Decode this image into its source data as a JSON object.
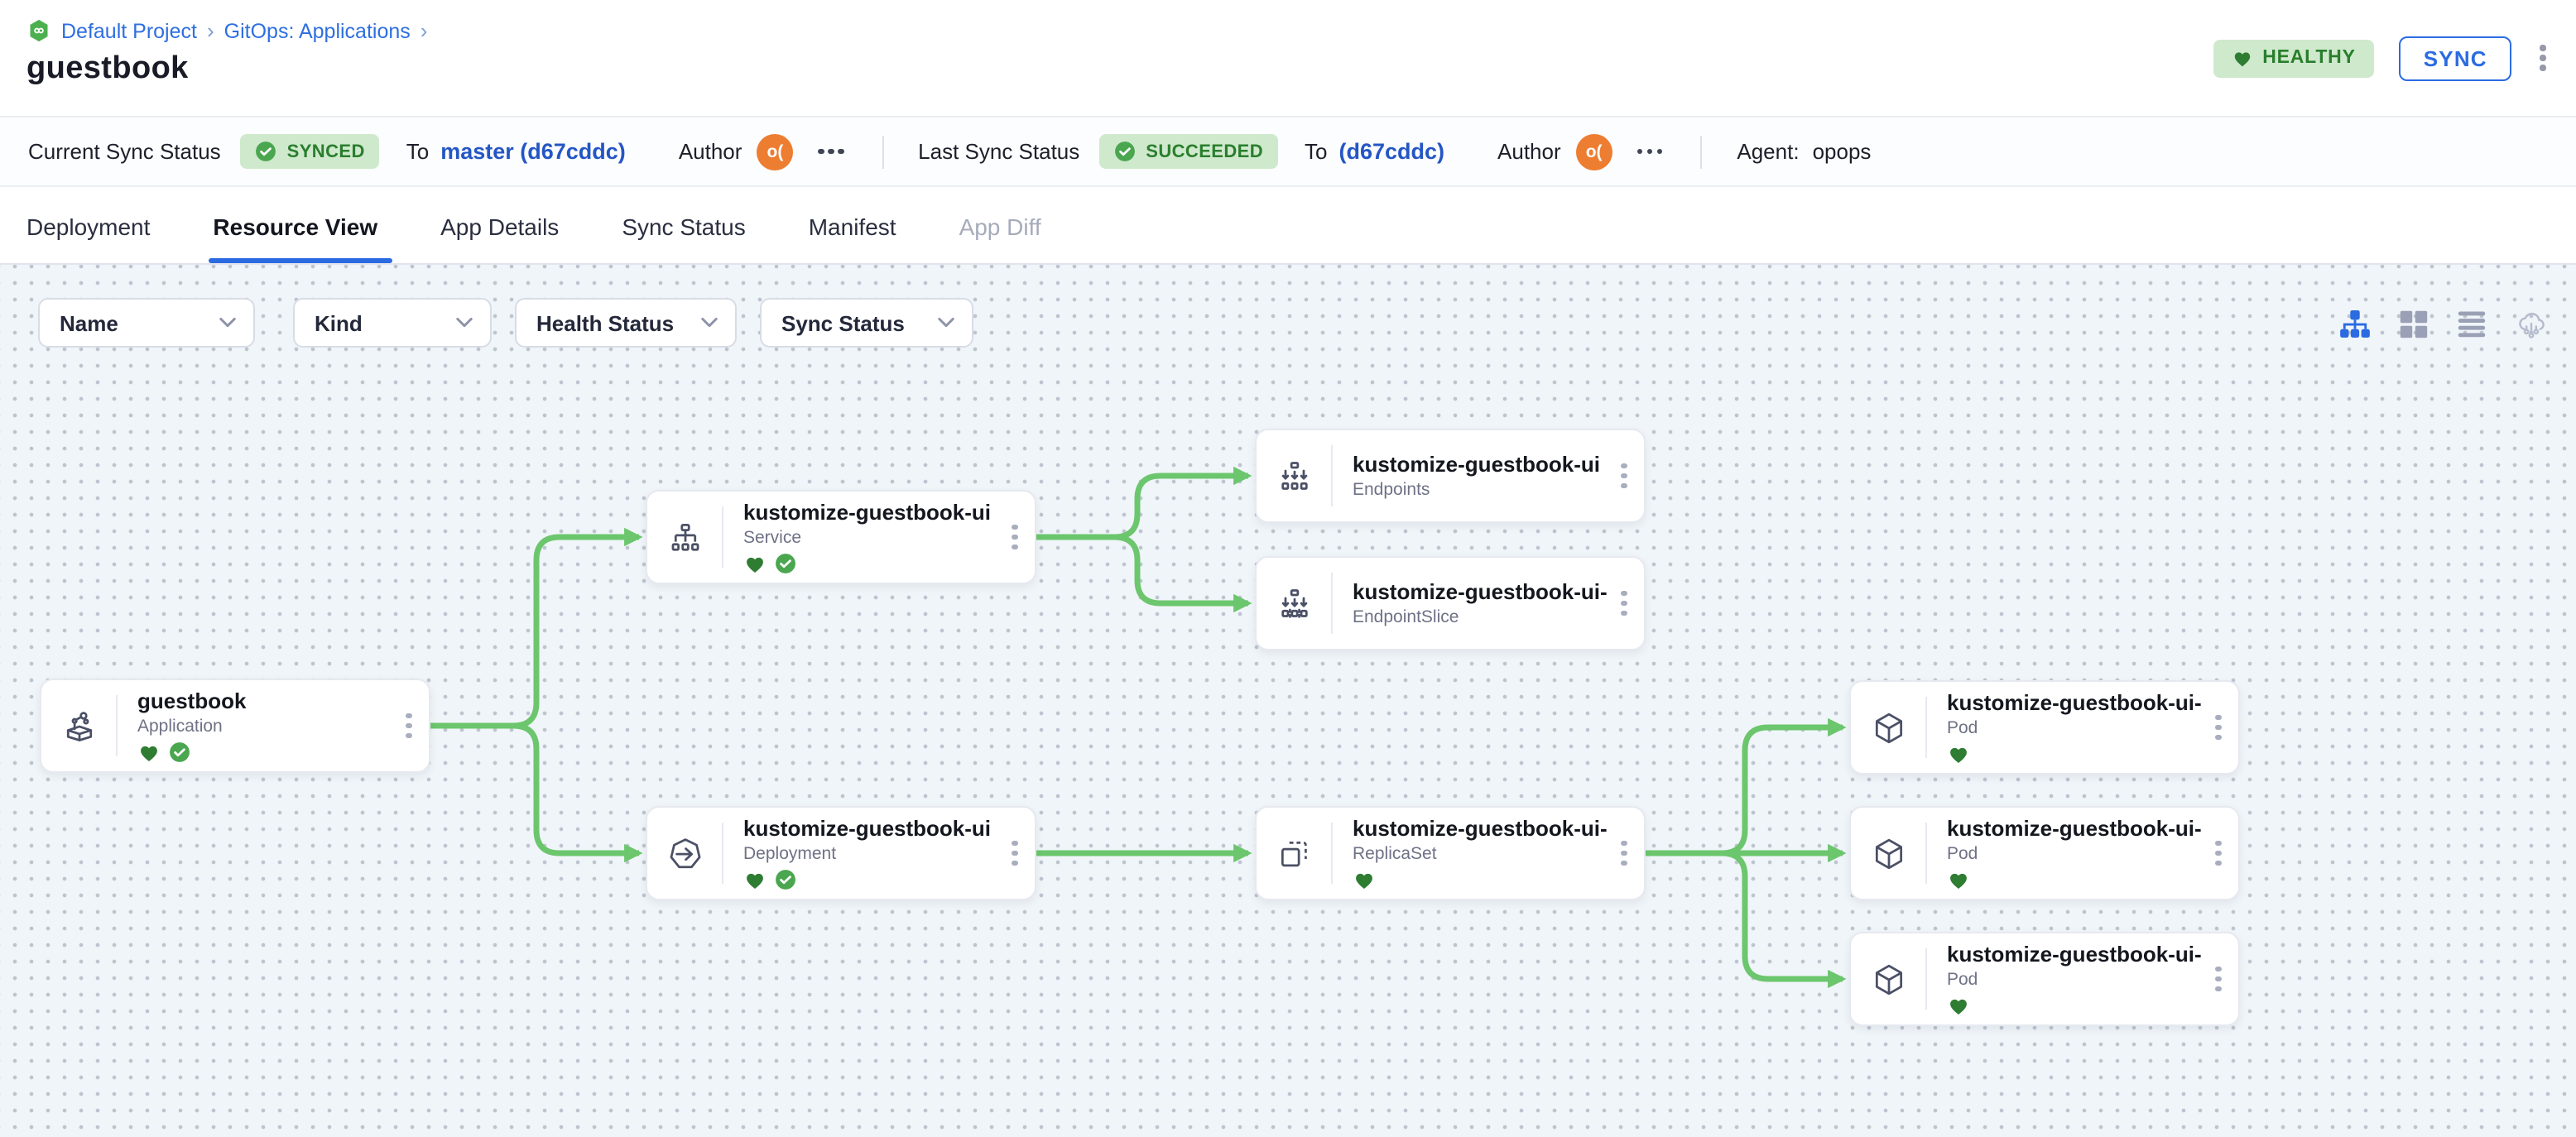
{
  "header": {
    "breadcrumb": {
      "project_icon": "project-hexagon-icon",
      "items": [
        "Default Project",
        "GitOps: Applications"
      ],
      "separator": "›"
    },
    "title": "guestbook",
    "health_badge": {
      "icon": "heart-icon",
      "label": "HEALTHY"
    },
    "sync_button": "SYNC",
    "more_menu_icon": "kebab-menu-icon"
  },
  "statusbar": {
    "current": {
      "label": "Current Sync Status",
      "badge": "SYNCED",
      "badge_icon": "check-circle-icon",
      "to_label": "To",
      "commit": "master (d67cddc)",
      "author_label": "Author",
      "author_initials": "o(",
      "more_icon": "more-options-icon"
    },
    "last": {
      "label": "Last Sync Status",
      "badge": "SUCCEEDED",
      "badge_icon": "check-circle-icon",
      "to_label": "To",
      "commit": "(d67cddc)",
      "author_label": "Author",
      "author_initials": "o(",
      "more_icon": "more-options-icon"
    },
    "agent": {
      "label": "Agent:",
      "value": "opops"
    }
  },
  "tabs": [
    {
      "label": "Deployment"
    },
    {
      "label": "Resource View",
      "active": true
    },
    {
      "label": "App Details"
    },
    {
      "label": "Sync Status"
    },
    {
      "label": "Manifest"
    },
    {
      "label": "App Diff",
      "disabled": true
    }
  ],
  "filters": [
    {
      "label": "Name"
    },
    {
      "label": "Kind"
    },
    {
      "label": "Health Status"
    },
    {
      "label": "Sync Status"
    }
  ],
  "view_toggles": [
    {
      "icon": "tree-view-icon",
      "active": true
    },
    {
      "icon": "grid-view-icon",
      "active": false
    },
    {
      "icon": "list-view-icon",
      "active": false
    },
    {
      "icon": "cloud-view-icon",
      "active": false
    }
  ],
  "graph": {
    "nodes": [
      {
        "id": "guestbook",
        "name": "guestbook",
        "kind": "Application",
        "healthy": true,
        "synced": true
      },
      {
        "id": "service",
        "name": "kustomize-guestbook-ui",
        "kind": "Service",
        "healthy": true,
        "synced": true
      },
      {
        "id": "endpoints",
        "name": "kustomize-guestbook-ui",
        "kind": "Endpoints",
        "healthy": false,
        "synced": false
      },
      {
        "id": "endpointslice",
        "name": "kustomize-guestbook-ui-...",
        "kind": "EndpointSlice",
        "healthy": false,
        "synced": false
      },
      {
        "id": "deployment",
        "name": "kustomize-guestbook-ui",
        "kind": "Deployment",
        "healthy": true,
        "synced": true
      },
      {
        "id": "replicaset",
        "name": "kustomize-guestbook-ui-...",
        "kind": "ReplicaSet",
        "healthy": true,
        "synced": false
      },
      {
        "id": "pod1",
        "name": "kustomize-guestbook-ui-...",
        "kind": "Pod",
        "healthy": true,
        "synced": false
      },
      {
        "id": "pod2",
        "name": "kustomize-guestbook-ui-...",
        "kind": "Pod",
        "healthy": true,
        "synced": false
      },
      {
        "id": "pod3",
        "name": "kustomize-guestbook-ui-...",
        "kind": "Pod",
        "healthy": true,
        "synced": false
      }
    ],
    "edges": [
      [
        "guestbook",
        "service"
      ],
      [
        "guestbook",
        "deployment"
      ],
      [
        "service",
        "endpoints"
      ],
      [
        "service",
        "endpointslice"
      ],
      [
        "deployment",
        "replicaset"
      ],
      [
        "replicaset",
        "pod1"
      ],
      [
        "replicaset",
        "pod2"
      ],
      [
        "replicaset",
        "pod3"
      ]
    ]
  },
  "colors": {
    "accent_blue": "#2b6be2",
    "commit_blue": "#2456c4",
    "edge_green": "#6cc66d",
    "badge_green_bg": "#cfe9cd",
    "badge_green_text": "#2a7e2d",
    "heart_green": "#2e7d32",
    "check_green": "#4aa64f",
    "avatar_orange": "#ed7d31"
  }
}
